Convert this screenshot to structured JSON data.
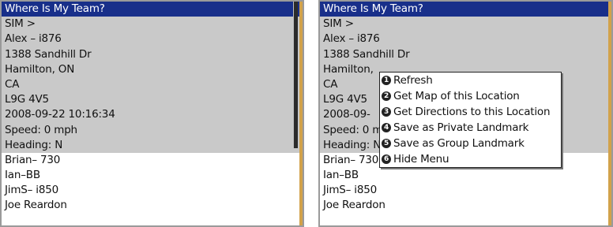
{
  "left": {
    "header": "Where Is My Team?",
    "details": [
      "SIM >",
      "Alex – i876",
      "1388 Sandhill Dr",
      "Hamilton, ON",
      "CA",
      "L9G 4V5",
      "2008-09-22 10:16:34",
      "Speed: 0 mph",
      "Heading: N"
    ],
    "members": [
      "Brian– 730",
      "Ian–BB",
      "JimS– i850",
      "Joe Reardon"
    ]
  },
  "right": {
    "header": "Where Is My Team?",
    "details": [
      "SIM >",
      "Alex – i876",
      "1388 Sandhill Dr",
      "Hamilton, ",
      "CA",
      "L9G 4V5",
      "2008-09-",
      "Speed: 0 m",
      "Heading: N"
    ],
    "members": [
      "Brian– 730",
      "Ian–BB",
      "JimS– i850",
      "Joe Reardon"
    ]
  },
  "menu": {
    "items": [
      {
        "num": "1",
        "label": "Refresh"
      },
      {
        "num": "2",
        "label": "Get Map of this Location"
      },
      {
        "num": "3",
        "label": "Get Directions to this Location"
      },
      {
        "num": "4",
        "label": "Save as Private Landmark"
      },
      {
        "num": "5",
        "label": "Save as Group Landmark"
      },
      {
        "num": "6",
        "label": "Hide Menu"
      }
    ],
    "selected_index": 0
  },
  "colors": {
    "header_bg": "#182f8a",
    "detail_bg": "#c9c9c9",
    "edge": "#d2a24a"
  }
}
